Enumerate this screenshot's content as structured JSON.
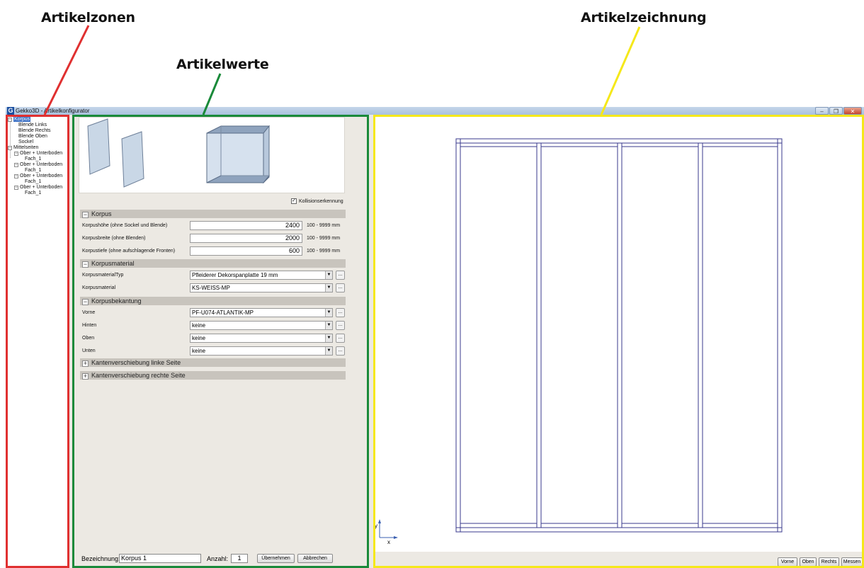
{
  "annotations": {
    "zones": "Artikelzonen",
    "values": "Artikelwerte",
    "drawing": "Artikelzeichnung"
  },
  "colors": {
    "zones_box": "#e03030",
    "values_box": "#1a8a3a",
    "drawing_box": "#f5e81a",
    "titlebar": "#b4c8e2",
    "tree_selected": "#3a6fc4",
    "drawing_lines": "#3a3a8c"
  },
  "window": {
    "title": "Gekko3D - Artikelkonfigurator",
    "app_icon": "G",
    "minimize": "–",
    "maximize": "❐",
    "close": "✕"
  },
  "tree": {
    "items": [
      {
        "label": "Korpus",
        "toggle": "−"
      },
      {
        "label": "Blende Links"
      },
      {
        "label": "Blende Rechts"
      },
      {
        "label": "Blende Oben"
      },
      {
        "label": "Sockel"
      },
      {
        "label": "Mittelseiten",
        "toggle": "−"
      },
      {
        "label": "Ober + Unterboden",
        "toggle": "−"
      },
      {
        "label": "Fach_1"
      },
      {
        "label": "Ober + Unterboden",
        "toggle": "−"
      },
      {
        "label": "Fach_1"
      },
      {
        "label": "Ober + Unterboden",
        "toggle": "−"
      },
      {
        "label": "Fach_1"
      },
      {
        "label": "Ober + Unterboden",
        "toggle": "−"
      },
      {
        "label": "Fach_1"
      }
    ]
  },
  "form": {
    "collision_label": "Kollisionserkennung",
    "collision_checked": true,
    "check_mark": "✓",
    "sections": {
      "korpus": {
        "title": "Korpus",
        "toggle": "−"
      },
      "material": {
        "title": "Korpusmaterial",
        "toggle": "−"
      },
      "kanten": {
        "title": "Korpusbekantung",
        "toggle": "−"
      },
      "links": {
        "title": "Kantenverschiebung linke Seite",
        "toggle": "+"
      },
      "rechts": {
        "title": "Kantenverschiebung rechte Seite",
        "toggle": "+"
      }
    },
    "dimensions": [
      {
        "label": "Korpushöhe (ohne Sockel und Blende)",
        "value": "2400",
        "range": "100 - 9999 mm"
      },
      {
        "label": "Korpusbreite (ohne Blenden)",
        "value": "2000",
        "range": "100 - 9999 mm"
      },
      {
        "label": "Korpustiefe (ohne aufschlagende Fronten)",
        "value": "600",
        "range": "100 - 9999 mm"
      }
    ],
    "material": [
      {
        "label": "KorpusmaterialTyp",
        "value": "Pfleiderer Dekorspanplatte 19 mm"
      },
      {
        "label": "Korpusmaterial",
        "value": "KS-WEISS-MP"
      }
    ],
    "edges": [
      {
        "label": "Vorne",
        "value": "PF-U074-ATLANTIK-MP"
      },
      {
        "label": "Hinten",
        "value": "keine"
      },
      {
        "label": "Oben",
        "value": "keine"
      },
      {
        "label": "Unten",
        "value": "keine"
      }
    ],
    "combo_arrow": "▼",
    "ellipsis": "..."
  },
  "bottom": {
    "name_label": "Bezeichnung:",
    "name_value": "Korpus 1",
    "count_label": "Anzahl:",
    "count_value": "1",
    "apply": "Übernehmen",
    "cancel": "Abbrechen"
  },
  "drawing": {
    "axis_y": "y",
    "axis_x": "x",
    "view_buttons": [
      "Vorne",
      "Oben",
      "Rechts",
      "Messen"
    ]
  }
}
